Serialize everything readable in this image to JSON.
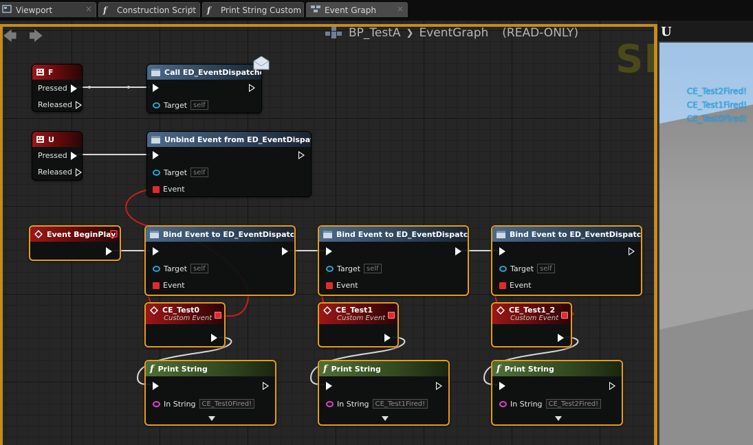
{
  "tabs": [
    {
      "label": "Viewport",
      "icon": "viewport-icon",
      "close": "×"
    },
    {
      "label": "Construction Script",
      "icon": "function-icon",
      "icon_glyph": "f",
      "close": "×"
    },
    {
      "label": "Print String Custom",
      "icon": "function-icon",
      "icon_glyph": "f",
      "close": "×"
    },
    {
      "label": "Event Graph",
      "icon": "graph-icon",
      "close": "×"
    }
  ],
  "nav": {
    "back": "🡄",
    "forward": "🡆"
  },
  "breadcrumb": {
    "blueprint": "BP_TestA",
    "separator": "❯",
    "graph": "EventGraph",
    "mode": "(READ-ONLY)"
  },
  "watermark": "SI",
  "nodes": {
    "key_f": {
      "title": "F",
      "pressed": "Pressed",
      "released": "Released"
    },
    "call_dispatcher": {
      "title": "Call ED_EventDispatcher",
      "target": "Target",
      "target_default": "self"
    },
    "key_u": {
      "title": "U",
      "pressed": "Pressed",
      "released": "Released"
    },
    "unbind": {
      "title": "Unbind Event from ED_EventDispatcher",
      "target": "Target",
      "target_default": "self",
      "event": "Event"
    },
    "begin_play": {
      "title": "Event BeginPlay"
    },
    "bind": [
      {
        "title": "Bind Event to ED_EventDispatcher",
        "target": "Target",
        "target_default": "self",
        "event": "Event"
      },
      {
        "title": "Bind Event to ED_EventDispatcher",
        "target": "Target",
        "target_default": "self",
        "event": "Event"
      },
      {
        "title": "Bind Event to ED_EventDispatcher",
        "target": "Target",
        "target_default": "self",
        "event": "Event"
      }
    ],
    "custom_events": [
      {
        "title": "CE_Test0",
        "subtitle": "Custom Event"
      },
      {
        "title": "CE_Test1",
        "subtitle": "Custom Event"
      },
      {
        "title": "CE_Test1_2",
        "subtitle": "Custom Event"
      }
    ],
    "print_strings": [
      {
        "title": "Print String",
        "in_string": "In String",
        "value": "CE_Test0Fired!"
      },
      {
        "title": "Print String",
        "in_string": "In String",
        "value": "CE_Test1Fired!"
      },
      {
        "title": "Print String",
        "in_string": "In String",
        "value": "CE_Test2Fired!"
      }
    ]
  },
  "viewport": {
    "logo": "U",
    "log_lines": [
      "CE_Test2Fired!",
      "CE_Test1Fired!",
      "CE_Test0Fired!"
    ]
  },
  "colors": {
    "selection": "#e69b1c",
    "exec_wire": "#ffffff",
    "delegate_wire": "#e12b2b",
    "object_pin": "#2aa3d6",
    "string_pin": "#e040c8",
    "event_header": "#9b1717",
    "function_header": "#4b6a8a",
    "log_text": "#27b6ff"
  }
}
